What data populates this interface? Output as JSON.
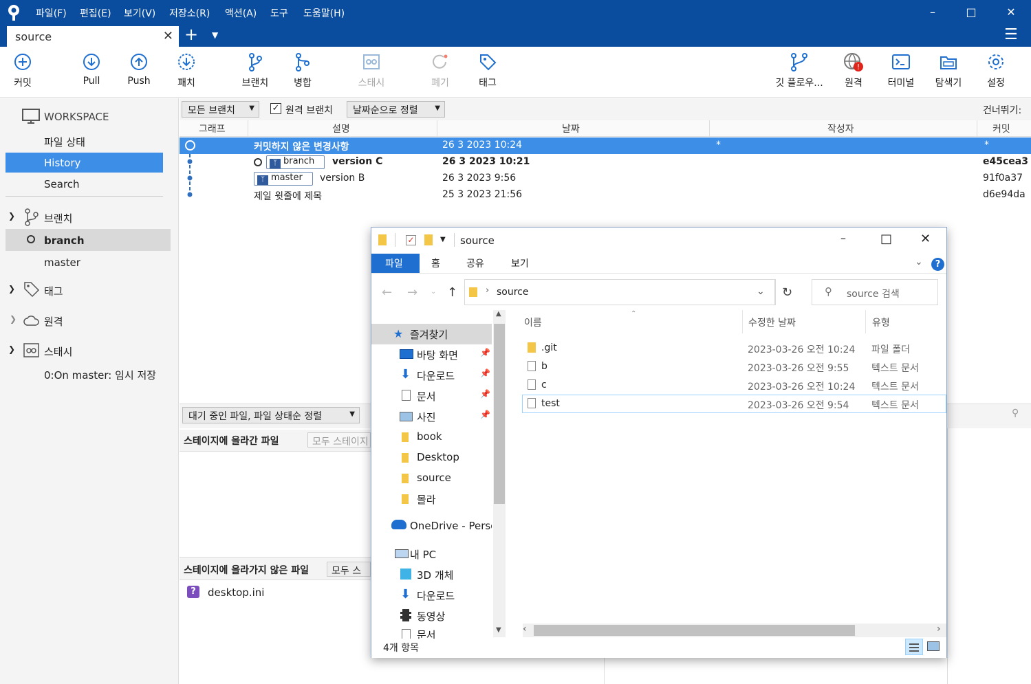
{
  "app": {
    "menu": [
      "파일(F)",
      "편집(E)",
      "보기(V)",
      "저장소(R)",
      "액션(A)",
      "도구",
      "도움말(H)"
    ],
    "tab_title": "source"
  },
  "toolbar": {
    "commit": "커밋",
    "pull": "Pull",
    "push": "Push",
    "patch": "패치",
    "branch": "브랜치",
    "merge": "병합",
    "stash": "스태시",
    "discard": "폐기",
    "tag": "태그",
    "gitflow": "깃 플로우...",
    "remote": "원격",
    "terminal": "터미널",
    "explorer": "탐색기",
    "settings": "설정"
  },
  "sidebar": {
    "workspace": "WORKSPACE",
    "file_status": "파일 상태",
    "history": "History",
    "search": "Search",
    "branches_header": "브랜치",
    "branches": [
      "branch",
      "master"
    ],
    "tags_header": "태그",
    "remotes_header": "원격",
    "stashes_header": "스태시",
    "stash_item": "0:On master: 임시 저장"
  },
  "filter": {
    "all_branches": "모든 브랜치",
    "remote_branches": "원격 브랜치",
    "sort": "날짜순으로 정렬",
    "skip": "건너뛰기:"
  },
  "columns": {
    "graph": "그래프",
    "desc": "설명",
    "date": "날짜",
    "author": "작성자",
    "commit": "커밋"
  },
  "commits": [
    {
      "desc": "커밋하지 않은 변경사항",
      "date": "26 3 2023 10:24",
      "author": "*",
      "hash": "*"
    },
    {
      "branch": "branch",
      "desc": "version C",
      "date": "26 3 2023 10:21",
      "hash": "e45cea3"
    },
    {
      "branch": "master",
      "desc": "version B",
      "date": "26 3 2023 9:56",
      "hash": "91f0a37"
    },
    {
      "desc": "제일 윗줄에 제목",
      "date": "25 3 2023 21:56",
      "hash": "d6e94da"
    }
  ],
  "lower": {
    "pending_sort": "대기 중인 파일, 파일 상태순 정렬",
    "staged": "스테이지에 올라간 파일",
    "unstage_all": "모두 스테이지",
    "unstaged": "스테이지에 올라가지 않은 파일",
    "stage_all": "모두 스",
    "unstaged_file": "desktop.ini"
  },
  "explorer": {
    "title": "source",
    "ribbon": [
      "파일",
      "홈",
      "공유",
      "보기"
    ],
    "path": "source",
    "search_placeholder": "source 검색",
    "nav": {
      "quick_access": "즐겨찾기",
      "desktop": "바탕 화면",
      "downloads": "다운로드",
      "documents": "문서",
      "pictures": "사진",
      "book": "book",
      "desktop_folder": "Desktop",
      "source": "source",
      "molla": "몰라",
      "onedrive": "OneDrive - Person",
      "this_pc": "내 PC",
      "objects3d": "3D 개체",
      "downloads2": "다운로드",
      "videos": "동영상",
      "documents2": "문서"
    },
    "headers": {
      "name": "이름",
      "modified": "수정한 날짜",
      "type": "유형"
    },
    "files": [
      {
        "name": ".git",
        "date": "2023-03-26 오전 10:24",
        "type": "파일 폴더"
      },
      {
        "name": "b",
        "date": "2023-03-26 오전 9:55",
        "type": "텍스트 문서"
      },
      {
        "name": "c",
        "date": "2023-03-26 오전 10:24",
        "type": "텍스트 문서"
      },
      {
        "name": "test",
        "date": "2023-03-26 오전 9:54",
        "type": "텍스트 문서"
      }
    ],
    "status": "4개 항목"
  },
  "colors": {
    "brand": "#0a4c9e",
    "selection": "#3d8ee6",
    "accent": "#1e6fd0"
  }
}
